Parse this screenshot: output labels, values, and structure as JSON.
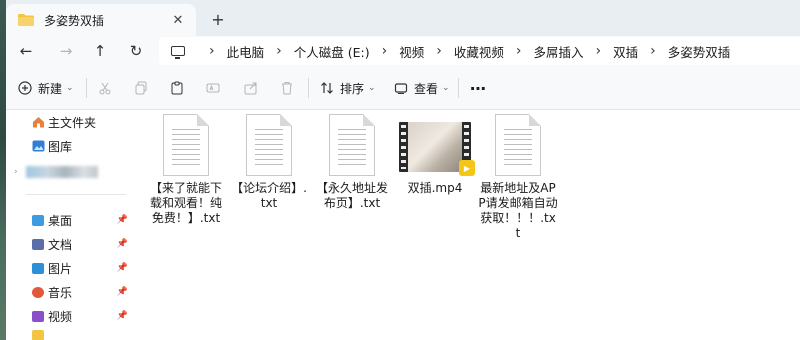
{
  "tab": {
    "title": "多姿势双插",
    "close": "✕",
    "new": "+"
  },
  "nav": {
    "back": "←",
    "forward": "→",
    "up": "↑",
    "refresh": "↻"
  },
  "breadcrumb": [
    "此电脑",
    "个人磁盘 (E:)",
    "视频",
    "收藏视频",
    "多屌插入",
    "双插",
    "多姿势双插"
  ],
  "breadcrumb_sep": "›",
  "toolbar": {
    "new_label": "新建",
    "new_chevron": "⌄",
    "sort_label": "排序",
    "sort_chevron": "⌄",
    "view_label": "查看",
    "view_chevron": "⌄",
    "more": "⋯"
  },
  "sidebar": {
    "items": [
      {
        "label": "主文件夹",
        "icon": "home-icon",
        "color": "#e8823a"
      },
      {
        "label": "图库",
        "icon": "gallery-icon",
        "color": "#2f7fd6"
      }
    ],
    "pinned": [
      {
        "label": "桌面",
        "icon": "desktop-icon",
        "color": "#3d9be0"
      },
      {
        "label": "文档",
        "icon": "documents-icon",
        "color": "#5a6ea8"
      },
      {
        "label": "图片",
        "icon": "pictures-icon",
        "color": "#2d8fd8"
      },
      {
        "label": "音乐",
        "icon": "music-icon",
        "color": "#e2583a"
      },
      {
        "label": "视频",
        "icon": "videos-icon",
        "color": "#8a4fc9"
      }
    ],
    "pin_glyph": "📌"
  },
  "files": [
    {
      "name": "【来了就能下载和观看！纯免费！】.txt",
      "type": "text",
      "icon": "text-file-icon"
    },
    {
      "name": "【论坛介绍】.txt",
      "type": "text",
      "icon": "text-file-icon"
    },
    {
      "name": "【永久地址发布页】.txt",
      "type": "text",
      "icon": "text-file-icon"
    },
    {
      "name": "双插.mp4",
      "type": "video",
      "icon": "video-file-icon"
    },
    {
      "name": "最新地址及APP请发邮箱自动获取！！！.txt",
      "type": "text",
      "icon": "text-file-icon"
    }
  ],
  "colors": {
    "accent": "#0067c0",
    "folder": "#f4c542",
    "badge": "#f5c518"
  }
}
